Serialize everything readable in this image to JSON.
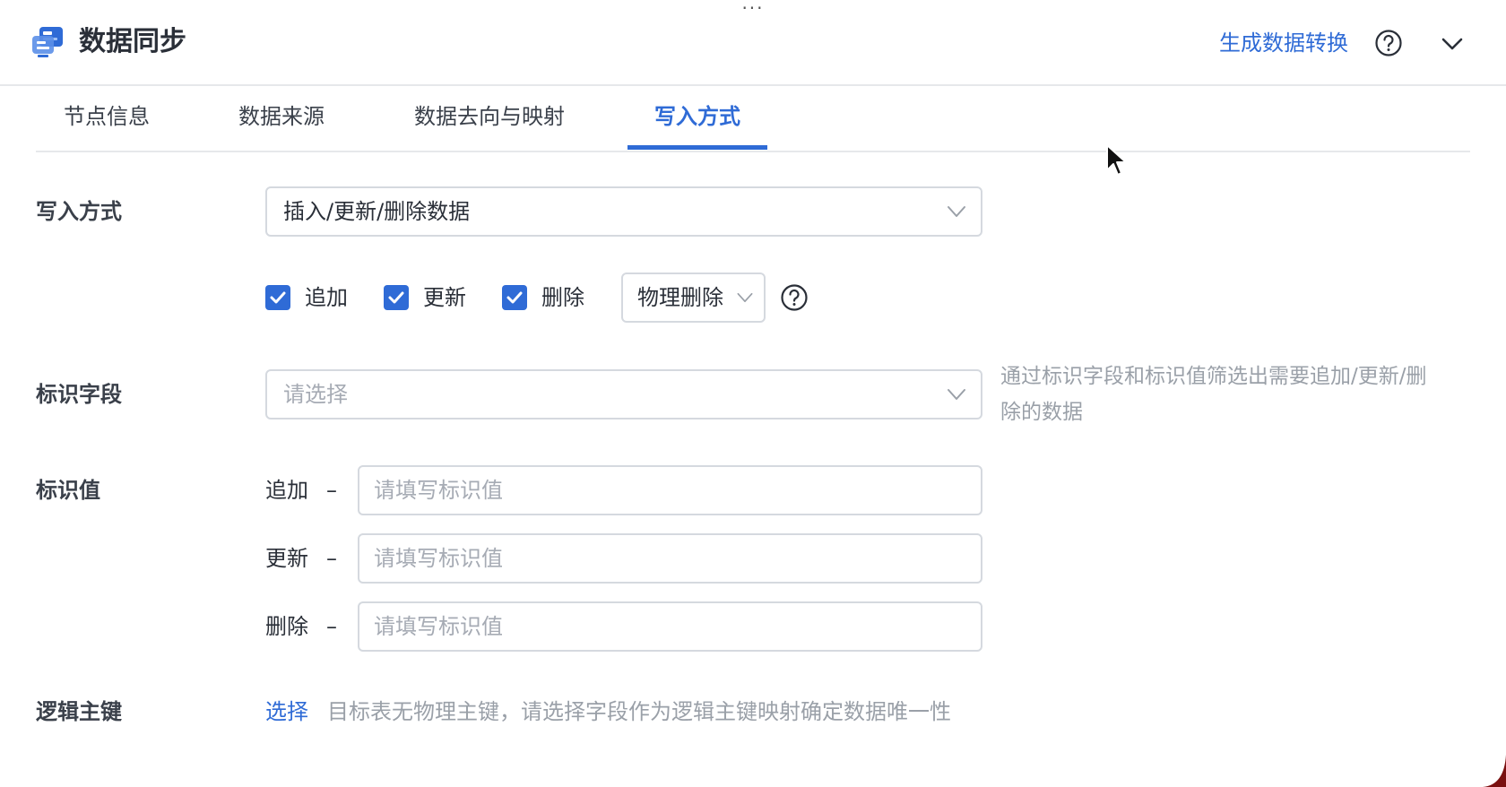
{
  "header": {
    "drag_handle": "···",
    "title": "数据同步",
    "generate_link": "生成数据转换",
    "help_icon": "help-circle-icon",
    "collapse_icon": "chevron-down-icon",
    "logo_icon": "data-sync-icon"
  },
  "tabs": [
    {
      "label": "节点信息"
    },
    {
      "label": "数据来源"
    },
    {
      "label": "数据去向与映射"
    },
    {
      "label": "写入方式",
      "active": true
    }
  ],
  "form": {
    "write_mode": {
      "label": "写入方式",
      "value": "插入/更新/删除数据"
    },
    "operations": {
      "append": {
        "label": "追加",
        "checked": true
      },
      "update": {
        "label": "更新",
        "checked": true
      },
      "delete": {
        "label": "删除",
        "checked": true
      },
      "delete_mode": "物理删除"
    },
    "id_field": {
      "label": "标识字段",
      "placeholder": "请选择",
      "hint_line1": "通过标识字段和标识值筛选出需要追加/更新/删",
      "hint_line2": "除的数据"
    },
    "id_values": {
      "label": "标识值",
      "dash": "–",
      "rows": [
        {
          "label": "追加",
          "placeholder": "请填写标识值",
          "value": ""
        },
        {
          "label": "更新",
          "placeholder": "请填写标识值",
          "value": ""
        },
        {
          "label": "删除",
          "placeholder": "请填写标识值",
          "value": ""
        }
      ]
    },
    "logical_key": {
      "label": "逻辑主键",
      "link": "选择",
      "description": "目标表无物理主键，请选择字段作为逻辑主键映射确定数据唯一性"
    }
  },
  "colors": {
    "accent": "#2f6bd6",
    "border": "#d5d9df",
    "placeholder": "#a6abb4",
    "hint": "#9aa0a8"
  }
}
